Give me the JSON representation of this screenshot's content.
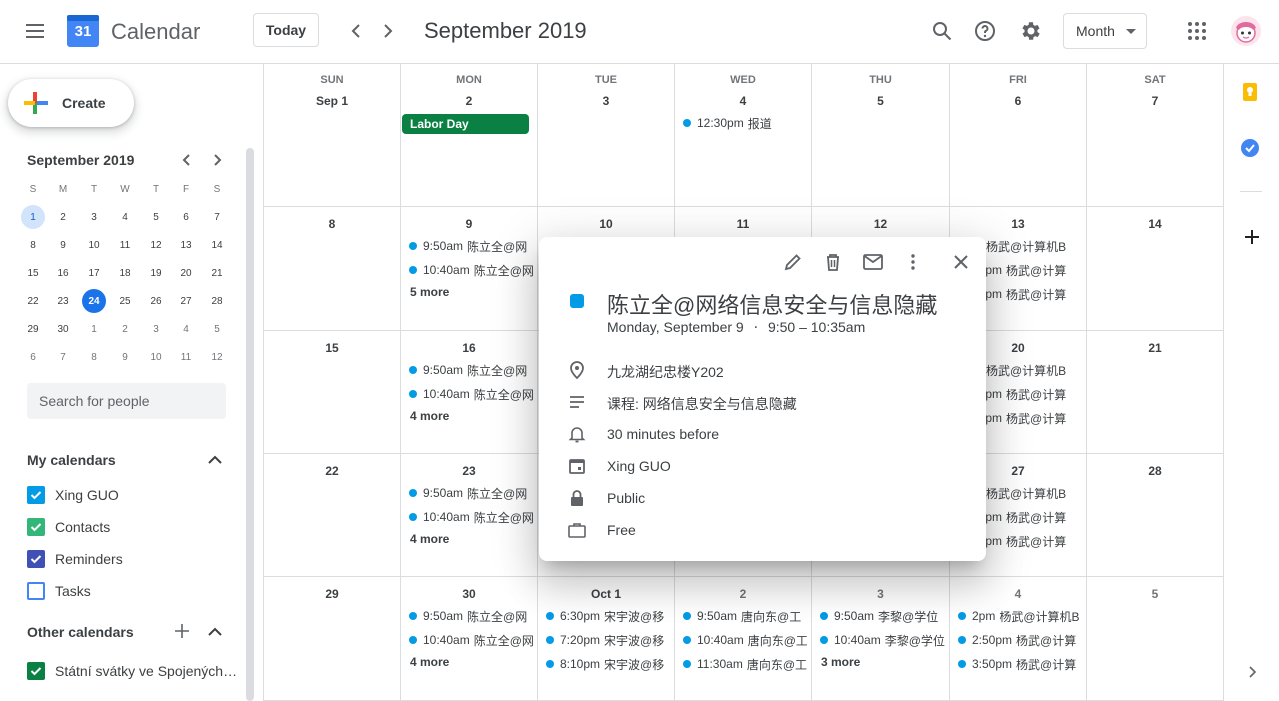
{
  "header": {
    "app_name": "Calendar",
    "logo_day": "31",
    "today_label": "Today",
    "period_title": "September 2019",
    "view_label": "Month"
  },
  "sidebar": {
    "create_label": "Create",
    "mini_cal": {
      "title": "September 2019",
      "dow": [
        "S",
        "M",
        "T",
        "W",
        "T",
        "F",
        "S"
      ],
      "weeks": [
        [
          "1",
          "2",
          "3",
          "4",
          "5",
          "6",
          "7"
        ],
        [
          "8",
          "9",
          "10",
          "11",
          "12",
          "13",
          "14"
        ],
        [
          "15",
          "16",
          "17",
          "18",
          "19",
          "20",
          "21"
        ],
        [
          "22",
          "23",
          "24",
          "25",
          "26",
          "27",
          "28"
        ],
        [
          "29",
          "30",
          "1",
          "2",
          "3",
          "4",
          "5"
        ],
        [
          "6",
          "7",
          "8",
          "9",
          "10",
          "11",
          "12"
        ]
      ]
    },
    "search_placeholder": "Search for people",
    "my_calendars_title": "My calendars",
    "my_calendars": [
      {
        "label": "Xing GUO",
        "color": "#039be5",
        "checked": true
      },
      {
        "label": "Contacts",
        "color": "#33b679",
        "checked": true
      },
      {
        "label": "Reminders",
        "color": "#3f51b5",
        "checked": true
      },
      {
        "label": "Tasks",
        "color": "#4285f4",
        "checked": false
      }
    ],
    "other_calendars_title": "Other calendars",
    "other_calendars": [
      {
        "label": "Státní svátky ve Spojených…",
        "color": "#0b8043",
        "checked": true
      }
    ]
  },
  "grid": {
    "dow": [
      "SUN",
      "MON",
      "TUE",
      "WED",
      "THU",
      "FRI",
      "SAT"
    ],
    "weeks": [
      {
        "days": [
          {
            "num": "Sep 1",
            "events": []
          },
          {
            "num": "2",
            "allday": "Labor Day",
            "events": []
          },
          {
            "num": "3",
            "events": []
          },
          {
            "num": "4",
            "events": [
              {
                "time": "12:30pm",
                "title": "报道"
              }
            ]
          },
          {
            "num": "5",
            "events": []
          },
          {
            "num": "6",
            "events": []
          },
          {
            "num": "7",
            "events": []
          }
        ]
      },
      {
        "days": [
          {
            "num": "8",
            "events": []
          },
          {
            "num": "9",
            "events": [
              {
                "time": "9:50am",
                "title": "陈立全@网"
              },
              {
                "time": "10:40am",
                "title": "陈立全@网"
              }
            ],
            "more": "5 more"
          },
          {
            "num": "10",
            "events": []
          },
          {
            "num": "11",
            "events": []
          },
          {
            "num": "12",
            "events": []
          },
          {
            "num": "13",
            "events": [
              {
                "time": "m",
                "title": "杨武@计算机B"
              },
              {
                "time": "50pm",
                "title": "杨武@计算"
              },
              {
                "time": "50pm",
                "title": "杨武@计算"
              }
            ]
          },
          {
            "num": "14",
            "events": []
          }
        ]
      },
      {
        "days": [
          {
            "num": "15",
            "events": []
          },
          {
            "num": "16",
            "events": [
              {
                "time": "9:50am",
                "title": "陈立全@网"
              },
              {
                "time": "10:40am",
                "title": "陈立全@网"
              }
            ],
            "more": "4 more"
          },
          {
            "num": "17",
            "events": []
          },
          {
            "num": "18",
            "events": []
          },
          {
            "num": "19",
            "events": []
          },
          {
            "num": "20",
            "events": [
              {
                "time": "m",
                "title": "杨武@计算机B"
              },
              {
                "time": "50pm",
                "title": "杨武@计算"
              },
              {
                "time": "50pm",
                "title": "杨武@计算"
              }
            ]
          },
          {
            "num": "21",
            "events": []
          }
        ]
      },
      {
        "days": [
          {
            "num": "22",
            "events": []
          },
          {
            "num": "23",
            "events": [
              {
                "time": "9:50am",
                "title": "陈立全@网"
              },
              {
                "time": "10:40am",
                "title": "陈立全@网"
              }
            ],
            "more": "4 more"
          },
          {
            "num": "24",
            "events": []
          },
          {
            "num": "25",
            "events": []
          },
          {
            "num": "26",
            "events": []
          },
          {
            "num": "27",
            "events": [
              {
                "time": "m",
                "title": "杨武@计算机B"
              },
              {
                "time": "50pm",
                "title": "杨武@计算"
              },
              {
                "time": "50pm",
                "title": "杨武@计算"
              }
            ]
          },
          {
            "num": "28",
            "events": []
          }
        ]
      },
      {
        "days": [
          {
            "num": "29",
            "events": []
          },
          {
            "num": "30",
            "events": [
              {
                "time": "9:50am",
                "title": "陈立全@网"
              },
              {
                "time": "10:40am",
                "title": "陈立全@网"
              }
            ],
            "more": "4 more"
          },
          {
            "num": "Oct 1",
            "events": [
              {
                "time": "6:30pm",
                "title": "宋宇波@移"
              },
              {
                "time": "7:20pm",
                "title": "宋宇波@移"
              },
              {
                "time": "8:10pm",
                "title": "宋宇波@移"
              }
            ]
          },
          {
            "num": "2",
            "events": [
              {
                "time": "9:50am",
                "title": "唐向东@工"
              },
              {
                "time": "10:40am",
                "title": "唐向东@工"
              },
              {
                "time": "11:30am",
                "title": "唐向东@工"
              }
            ]
          },
          {
            "num": "3",
            "events": [
              {
                "time": "9:50am",
                "title": "李黎@学位"
              },
              {
                "time": "10:40am",
                "title": "李黎@学位"
              }
            ],
            "more": "3 more"
          },
          {
            "num": "4",
            "events": [
              {
                "time": "2pm",
                "title": "杨武@计算机B"
              },
              {
                "time": "2:50pm",
                "title": "杨武@计算"
              },
              {
                "time": "3:50pm",
                "title": "杨武@计算"
              }
            ]
          },
          {
            "num": "5",
            "events": []
          }
        ]
      }
    ]
  },
  "popup": {
    "title": "陈立全@网络信息安全与信息隐藏",
    "color": "#039be5",
    "date_text": "Monday, September 9",
    "separator": "⋅",
    "time_text": "9:50 – 10:35am",
    "location": "九龙湖纪忠楼Y202",
    "description": "课程: 网络信息安全与信息隐藏",
    "reminder": "30 minutes before",
    "calendar": "Xing GUO",
    "visibility": "Public",
    "availability": "Free"
  }
}
